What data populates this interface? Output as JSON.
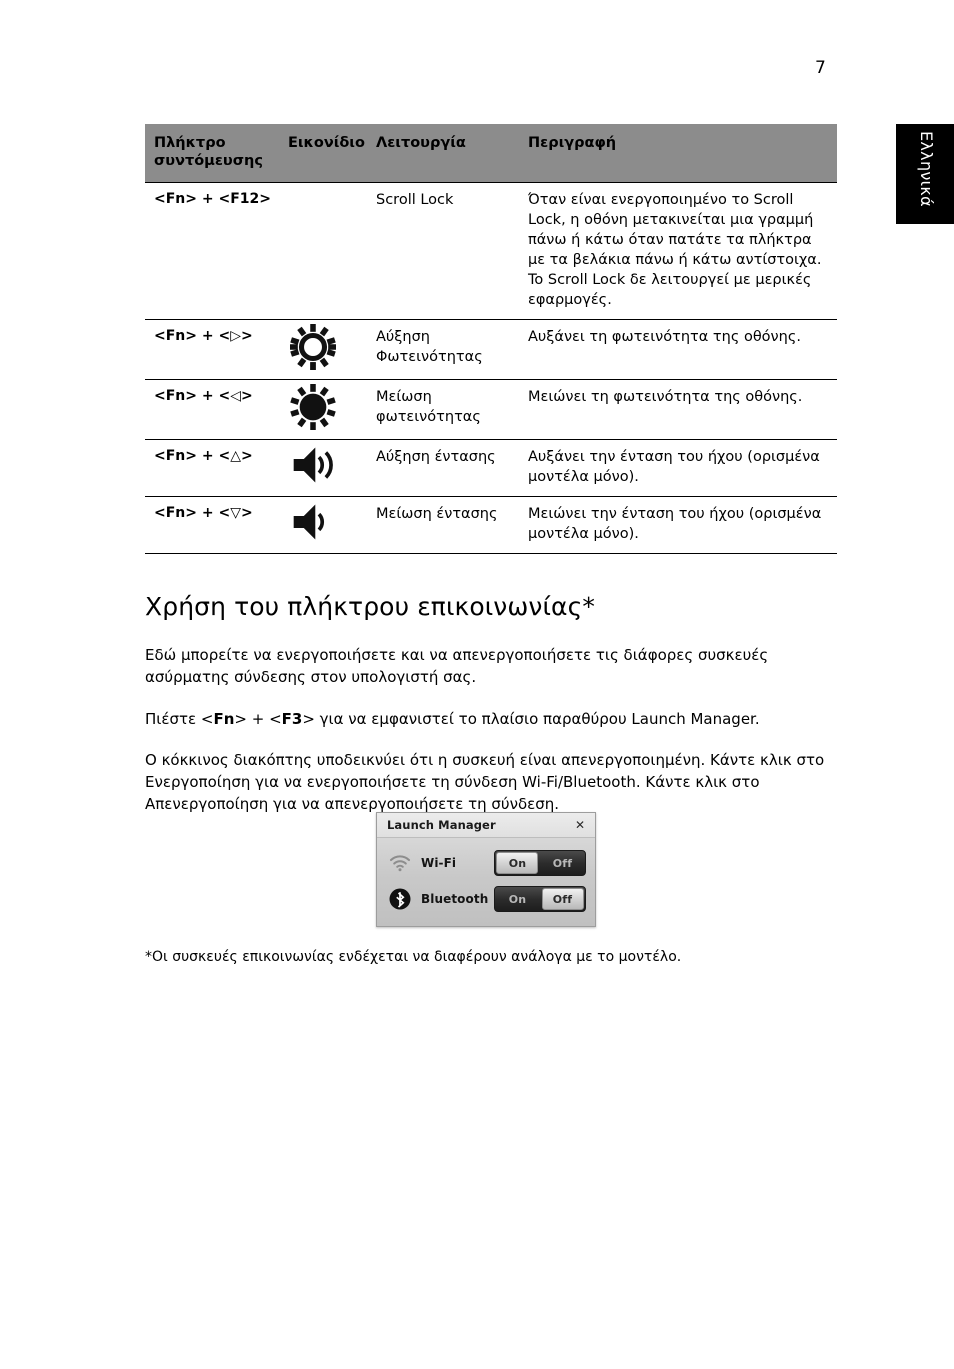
{
  "page": {
    "number": "7",
    "language_tab": "Ελληνικά"
  },
  "table": {
    "headers": [
      "Πλήκτρο συντόμευσης",
      "Εικονίδιο",
      "Λειτουργία",
      "Περιγραφή"
    ],
    "rows": [
      {
        "key": "<Fn> + <F12>",
        "icon": "none",
        "function": "Scroll Lock",
        "description": "Όταν είναι ενεργοποιημένο το Scroll Lock, η οθόνη μετακινείται μια γραμμή πάνω ή κάτω όταν πατάτε τα πλήκτρα με τα βελάκια πάνω ή κάτω αντίστοιχα. To Scroll Lock δε λειτουργεί με μερικές εφαρμογές."
      },
      {
        "key": "<Fn> + <▷>",
        "icon": "brightness-up-icon",
        "function": "Αύξηση Φωτεινότητας",
        "description": "Αυξάνει τη φωτεινότητα της οθόνης."
      },
      {
        "key": "<Fn> + <◁>",
        "icon": "brightness-down-icon",
        "function": "Μείωση φωτεινότητας",
        "description": "Μειώνει τη φωτεινότητα της οθόνης."
      },
      {
        "key": "<Fn> + <△>",
        "icon": "volume-up-icon",
        "function": "Αύξηση έντασης",
        "description": "Αυξάνει την ένταση του ήχου (ορισμένα μοντέλα μόνο)."
      },
      {
        "key": "<Fn> + <▽>",
        "icon": "volume-down-icon",
        "function": "Μείωση έντασης",
        "description": "Μειώνει την ένταση του ήχου (ορισμένα μοντέλα μόνο)."
      }
    ]
  },
  "section": {
    "title": "Χρήση του πλήκτρου επικοινωνίας*",
    "paragraph1": "Εδώ μπορείτε να ενεργοποιήσετε και να απενεργοποιήσετε τις διάφορες συσκευές ασύρματης σύνδεσης στον υπολογιστή σας.",
    "paragraph2": {
      "before": "Πιέστε <",
      "key1": "Fn",
      "middle": "> + <",
      "key2": "F3",
      "after": "> για να εμφανιστεί το πλαίσιο παραθύρου Launch Manager."
    },
    "paragraph3": "Ο κόκκινος διακόπτης υποδεικνύει ότι η συσκευή είναι απενεργοποιημένη. Κάντε κλικ στο Ενεργοποίηση για να ενεργοποιήσετε τη σύνδεση Wi-Fi/Bluetooth. Κάντε κλικ στο Απενεργοποίηση για να απενεργοποιήσετε τη σύνδεση.",
    "footnote": "*Οι συσκευές επικοινωνίας ενδέχεται να διαφέρουν ανάλογα με το μοντέλο."
  },
  "dialog": {
    "title": "Launch Manager",
    "close_label": "✕",
    "rows": [
      {
        "icon": "wifi-icon",
        "label": "Wi-Fi",
        "on_label": "On",
        "off_label": "Off",
        "state": "on"
      },
      {
        "icon": "bluetooth-icon",
        "label": "Bluetooth",
        "on_label": "On",
        "off_label": "Off",
        "state": "off"
      }
    ]
  },
  "colors": {
    "table_header_bg": "#8c8c8c",
    "language_tab_bg": "#000000",
    "text": "#000000"
  }
}
